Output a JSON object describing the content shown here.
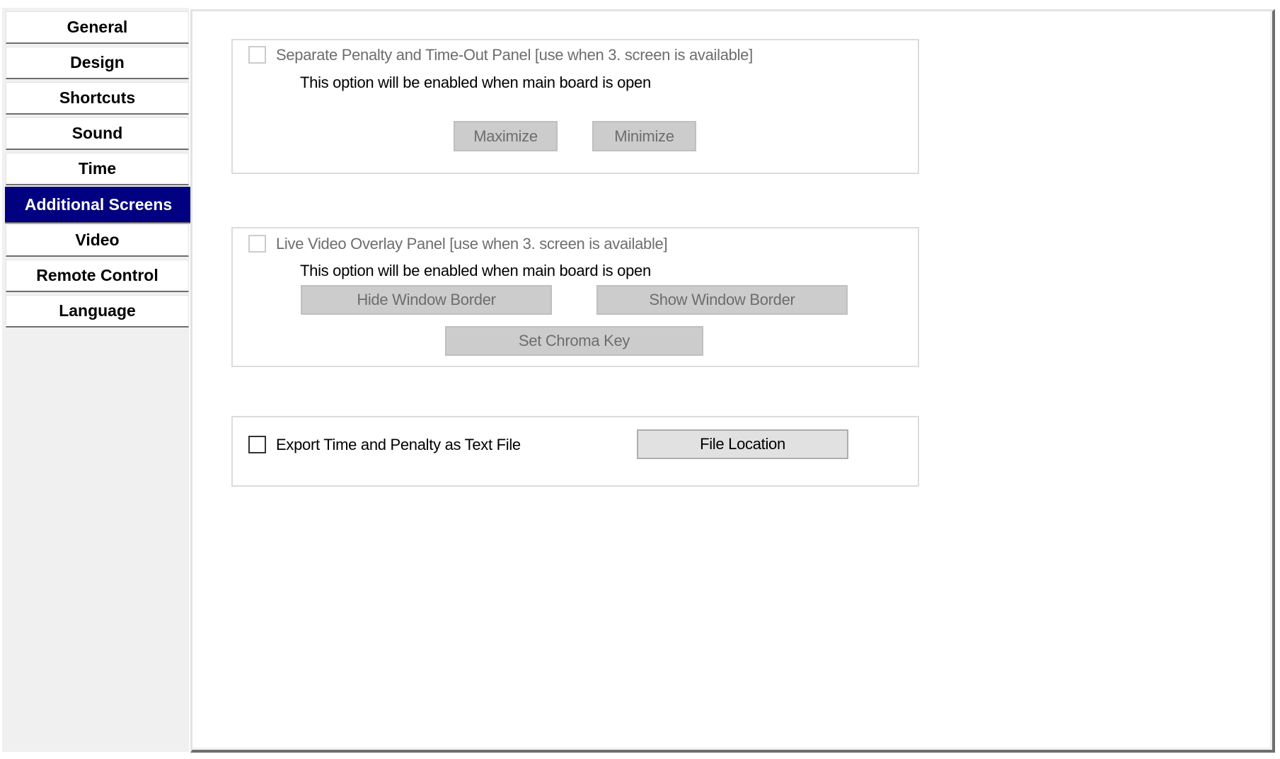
{
  "sidebar": {
    "items": [
      {
        "label": "General",
        "active": false
      },
      {
        "label": "Design",
        "active": false
      },
      {
        "label": "Shortcuts",
        "active": false
      },
      {
        "label": "Sound",
        "active": false
      },
      {
        "label": "Time",
        "active": false
      },
      {
        "label": "Additional Screens",
        "active": true
      },
      {
        "label": "Video",
        "active": false
      },
      {
        "label": "Remote Control",
        "active": false
      },
      {
        "label": "Language",
        "active": false
      }
    ],
    "active_color": "#000080"
  },
  "penalty_panel": {
    "checkbox_label": "Separate Penalty and Time-Out Panel [use when 3. screen is available]",
    "checked": false,
    "enabled": false,
    "info": "This option will be enabled when main board is open",
    "maximize_label": "Maximize",
    "minimize_label": "Minimize"
  },
  "video_overlay_panel": {
    "checkbox_label": "Live Video Overlay Panel [use when 3. screen is available]",
    "checked": false,
    "enabled": false,
    "info": "This option will be enabled when main board is open",
    "hide_border_label": "Hide Window Border",
    "show_border_label": "Show Window Border",
    "chroma_key_label": "Set Chroma Key"
  },
  "export_panel": {
    "checkbox_label": "Export Time and Penalty as Text File",
    "checked": false,
    "enabled": true,
    "file_location_label": "File Location"
  }
}
